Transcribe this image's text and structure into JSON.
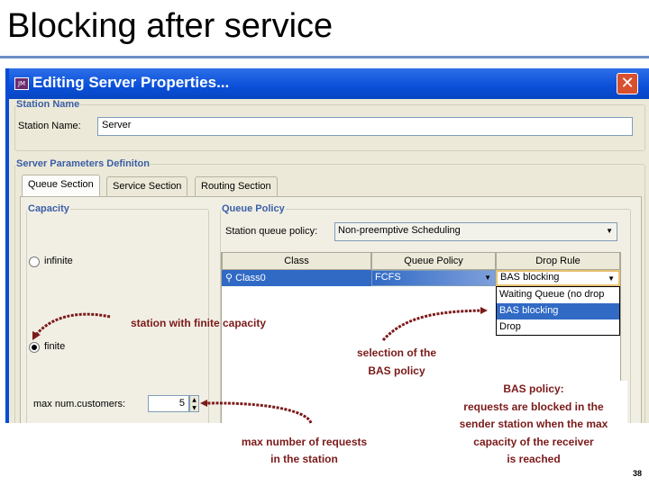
{
  "slide": {
    "title": "Blocking after service",
    "page_number": "38"
  },
  "dialog": {
    "title": "Editing Server Properties...",
    "close_label": "✕",
    "station_group": {
      "legend": "Station Name",
      "label": "Station Name:",
      "value": "Server"
    },
    "params_group": {
      "legend": "Server Parameters Definiton"
    },
    "tabs": [
      {
        "label": "Queue Section",
        "active": true
      },
      {
        "label": "Service Section"
      },
      {
        "label": "Routing Section"
      }
    ],
    "capacity": {
      "legend": "Capacity",
      "infinite_label": "infinite",
      "finite_label": "finite",
      "selected": "finite",
      "max_label": "max num.customers:",
      "max_value": "5"
    },
    "queue_policy": {
      "legend": "Queue Policy",
      "station_policy_label": "Station queue policy:",
      "station_policy_value": "Non-preemptive Scheduling",
      "table": {
        "headers": [
          "Class",
          "Queue Policy",
          "Drop Rule"
        ],
        "rows": [
          {
            "class": "Class0",
            "queue_policy": "FCFS",
            "drop_rule": "BAS blocking"
          }
        ]
      },
      "drop_options": [
        "Waiting Queue (no drop",
        "BAS blocking",
        "Drop"
      ],
      "drop_highlighted": "BAS blocking"
    }
  },
  "annotations": {
    "finite": "station with finite capacity",
    "bas_selection": [
      "selection of the",
      "BAS policy"
    ],
    "max_requests": [
      "max number of requests",
      "in the station"
    ],
    "bas_policy": [
      "BAS policy:",
      "requests are blocked in the",
      "sender station when the max",
      "capacity of the receiver",
      "is reached"
    ]
  },
  "colors": {
    "accent": "#0a4fd8",
    "annotation": "#7b1a1a",
    "selection": "#316ac5"
  }
}
